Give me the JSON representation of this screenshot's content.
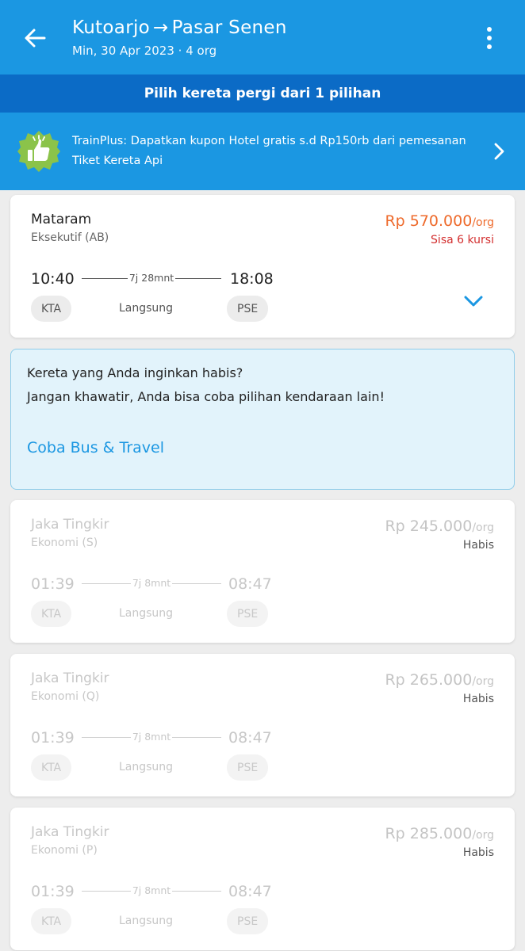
{
  "header": {
    "origin": "Kutoarjo",
    "arrow": "→",
    "destination": "Pasar Senen",
    "subtitle": "Min, 30 Apr 2023 · 4 org"
  },
  "selection_banner": "Pilih kereta pergi dari 1 pilihan",
  "promo": {
    "text": "TrainPlus: Dapatkan kupon Hotel gratis s.d Rp150rb dari pemesanan Tiket Kereta Api",
    "badge_color": "#8bc34a"
  },
  "colors": {
    "primary": "#1b97e2",
    "banner": "#0b6bc6",
    "price": "#ee6a2b",
    "seats_warning": "#d32f2f"
  },
  "trains": [
    {
      "name": "Mataram",
      "class": "Eksekutif (AB)",
      "price": "Rp 570.000",
      "unit": "/org",
      "status": "Sisa 6 kursi",
      "depart": "10:40",
      "duration": "7j 28mnt",
      "arrive": "18:08",
      "from": "KTA",
      "type": "Langsung",
      "to": "PSE"
    },
    {
      "name": "Jaka Tingkir",
      "class": "Ekonomi (S)",
      "price": "Rp 245.000",
      "unit": "/org",
      "status": "Habis",
      "depart": "01:39",
      "duration": "7j 8mnt",
      "arrive": "08:47",
      "from": "KTA",
      "type": "Langsung",
      "to": "PSE"
    },
    {
      "name": "Jaka Tingkir",
      "class": "Ekonomi (Q)",
      "price": "Rp 265.000",
      "unit": "/org",
      "status": "Habis",
      "depart": "01:39",
      "duration": "7j 8mnt",
      "arrive": "08:47",
      "from": "KTA",
      "type": "Langsung",
      "to": "PSE"
    },
    {
      "name": "Jaka Tingkir",
      "class": "Ekonomi (P)",
      "price": "Rp 285.000",
      "unit": "/org",
      "status": "Habis",
      "depart": "01:39",
      "duration": "7j 8mnt",
      "arrive": "08:47",
      "from": "KTA",
      "type": "Langsung",
      "to": "PSE"
    }
  ],
  "sold_out_info": {
    "line1": "Kereta yang Anda inginkan habis?",
    "line2": "Jangan khawatir, Anda bisa coba pilihan kendaraan lain!",
    "link": "Coba Bus & Travel"
  },
  "icons": {
    "back": "arrow-left-icon",
    "more": "more-vertical-icon",
    "promo": "thumbs-up-badge-icon",
    "promo_chevron": "chevron-right-icon",
    "expand": "chevron-down-icon"
  }
}
